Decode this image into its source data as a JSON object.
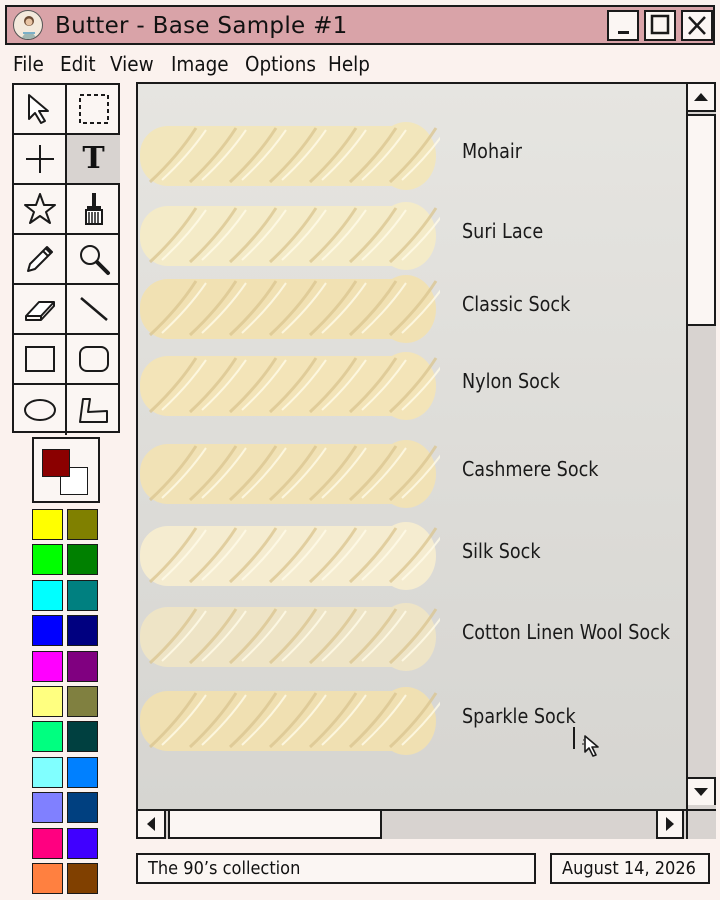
{
  "window": {
    "title": "Butter - Base Sample #1",
    "icon": "knitter-avatar-icon",
    "controls": [
      "minimize-icon",
      "maximize-icon",
      "close-icon"
    ]
  },
  "menu": [
    "File",
    "Edit",
    "View",
    "Image",
    "Options",
    "Help"
  ],
  "tools": [
    {
      "name": "select-arrow-icon"
    },
    {
      "name": "rectangle-select-icon"
    },
    {
      "name": "crosshair-icon"
    },
    {
      "name": "text-tool-icon",
      "label": "T",
      "active": true
    },
    {
      "name": "star-icon"
    },
    {
      "name": "brush-icon"
    },
    {
      "name": "pencil-icon"
    },
    {
      "name": "magnifier-icon"
    },
    {
      "name": "eraser-icon"
    },
    {
      "name": "line-icon"
    },
    {
      "name": "rectangle-icon"
    },
    {
      "name": "rounded-rectangle-icon"
    },
    {
      "name": "ellipse-icon"
    },
    {
      "name": "polygon-icon"
    }
  ],
  "colors": {
    "foreground": "#8b0000",
    "background": "#ffffff",
    "palette": [
      "#ffff00",
      "#808000",
      "#00ff00",
      "#008000",
      "#00ffff",
      "#008080",
      "#0000ff",
      "#000080",
      "#ff00ff",
      "#800080",
      "#ffff80",
      "#808040",
      "#00ff80",
      "#004040",
      "#80ffff",
      "#0080ff",
      "#8080ff",
      "#004080",
      "#ff0080",
      "#4000ff",
      "#ff8040",
      "#804000"
    ]
  },
  "yarns": [
    {
      "label": "Mohair",
      "color": "#f2e6bc"
    },
    {
      "label": "Suri Lace",
      "color": "#f4ebc8"
    },
    {
      "label": "Classic Sock",
      "color": "#f1e1b3"
    },
    {
      "label": "Nylon Sock",
      "color": "#f3e4b8"
    },
    {
      "label": "Cashmere Sock",
      "color": "#f1e2b6"
    },
    {
      "label": "Silk Sock",
      "color": "#f5ecd0"
    },
    {
      "label": "Cotton Linen Wool Sock",
      "color": "#eee4c6"
    },
    {
      "label": "Sparkle Sock",
      "color": "#f0e0b2"
    }
  ],
  "status": {
    "left": "The 90’s collection",
    "right": "August 14, 2026"
  }
}
